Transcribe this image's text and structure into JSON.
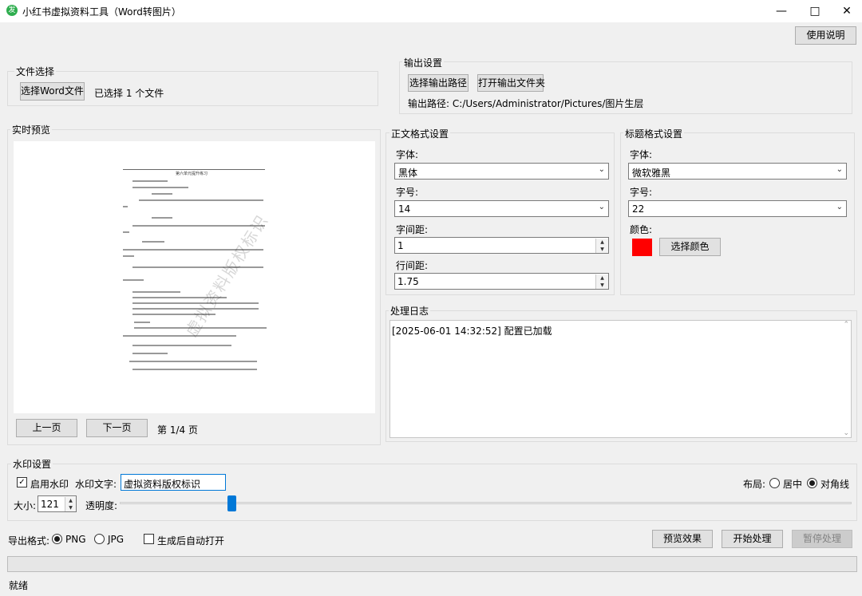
{
  "window": {
    "title": "小红书虚拟资料工具（Word转图片）",
    "icon_glyph": "发",
    "minimize_icon": "minimize-icon",
    "maximize_icon": "maximize-icon",
    "close_icon": "close-icon"
  },
  "header": {
    "help_label": "使用说明"
  },
  "file_select": {
    "group_label": "文件选择",
    "button_label": "选择Word文件",
    "status": "已选择 1 个文件"
  },
  "output": {
    "group_label": "输出设置",
    "choose_path_label": "选择输出路径",
    "open_folder_label": "打开输出文件夹",
    "path_text": "输出路径: C:/Users/Administrator/Pictures/图片生层"
  },
  "preview": {
    "group_label": "实时预览",
    "doc_title": "第六单元提升练习",
    "watermark": "虚拟资料版权标识",
    "prev_label": "上一页",
    "next_label": "下一页",
    "page_info": "第 1/4 页"
  },
  "body_format": {
    "group_label": "正文格式设置",
    "font_label": "字体:",
    "font_value": "黑体",
    "size_label": "字号:",
    "size_value": "14",
    "spacing_label": "字间距:",
    "spacing_value": "1",
    "line_label": "行间距:",
    "line_value": "1.75"
  },
  "title_format": {
    "group_label": "标题格式设置",
    "font_label": "字体:",
    "font_value": "微软雅黑",
    "size_label": "字号:",
    "size_value": "22",
    "color_label": "颜色:",
    "color_value": "#ff0000",
    "choose_color_label": "选择颜色"
  },
  "log": {
    "group_label": "处理日志",
    "lines": [
      "[2025-06-01 14:32:52] 配置已加载"
    ]
  },
  "watermark": {
    "group_label": "水印设置",
    "enable_label": "启用水印",
    "enabled": true,
    "text_label": "水印文字:",
    "text_value": "虚拟资料版权标识",
    "layout_label": "布局:",
    "layout_center_label": "居中",
    "layout_diag_label": "对角线",
    "layout_selected": "对角线",
    "size_label": "大小:",
    "size_value": "121",
    "opacity_label": "透明度:",
    "opacity_fraction": 0.15
  },
  "export": {
    "format_label": "导出格式:",
    "png_label": "PNG",
    "jpg_label": "JPG",
    "selected": "PNG",
    "auto_open_label": "生成后自动打开",
    "auto_open": false,
    "preview_label": "预览效果",
    "start_label": "开始处理",
    "pause_label": "暂停处理"
  },
  "progress": {
    "value": 0
  },
  "status": {
    "text": "就绪"
  }
}
